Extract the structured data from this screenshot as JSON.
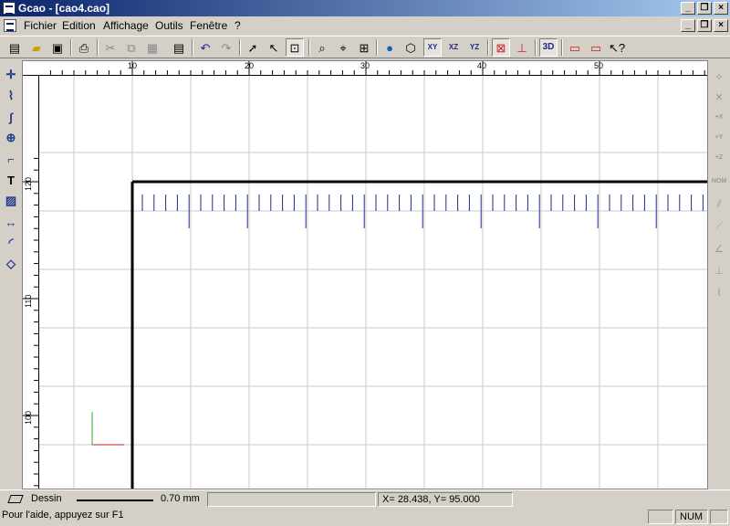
{
  "window": {
    "title": "Gcao - [cao4.cao]"
  },
  "menu": {
    "items": [
      "Fichier",
      "Edition",
      "Affichage",
      "Outils",
      "Fenêtre",
      "?"
    ]
  },
  "toolbar": {
    "icons": [
      "new-icon",
      "open-icon",
      "save-icon",
      "print-icon",
      "cut-icon",
      "copy-icon",
      "paste-icon",
      "properties-icon",
      "undo-icon",
      "redo-icon",
      "select-arrow-icon",
      "edit-arrow-icon",
      "zoom-window-icon",
      "zoom-icon",
      "zoom-move-icon",
      "zoom-grid-icon",
      "globe-icon",
      "cube-icon",
      "plane-xy-icon",
      "plane-xz-icon",
      "plane-yz-icon",
      "snap-grid-icon",
      "snap-point-icon",
      "3d-icon",
      "frame-icon",
      "frame-3d-icon",
      "help-context-icon"
    ],
    "label_3d": "3D",
    "label_xy": "XY",
    "label_xz": "XZ",
    "label_yz": "YZ"
  },
  "left_tools": {
    "icons": [
      "point-icon",
      "polyline-icon",
      "curve-icon",
      "circle-icon",
      "transform-icon",
      "text-icon",
      "hatch-icon",
      "dimension-icon",
      "arc-dimension-icon",
      "eraser-icon"
    ],
    "text_glyph": "T"
  },
  "right_tools": {
    "icons": [
      "snap-end-icon",
      "snap-intersection-icon",
      "axis-x-icon",
      "axis-y-icon",
      "axis-z-icon",
      "normal-icon",
      "parallel-icon",
      "tangent-icon",
      "angle-icon",
      "perpendicular-icon",
      "curve-snap-icon"
    ],
    "labels": {
      "x": "+X",
      "y": "+Y",
      "z": "+Z",
      "nom": "NOM"
    }
  },
  "rulers": {
    "top_labels": [
      "10",
      "20",
      "30",
      "40",
      "50"
    ],
    "left_labels": [
      "120",
      "110",
      "100"
    ]
  },
  "status": {
    "mode": "Dessin",
    "line_width": "0.70 mm",
    "coords_label": "X=   28.438, Y=     95.000",
    "help": "Pour l'aide, appuyez sur F1",
    "num": "NUM"
  },
  "colors": {
    "title_start": "#0a246a",
    "title_end": "#a6caf0",
    "grid": "#c8c8c8",
    "tick_blue": "#1c2b8c",
    "axis_x": "#cc2222",
    "axis_y": "#22aa22"
  }
}
